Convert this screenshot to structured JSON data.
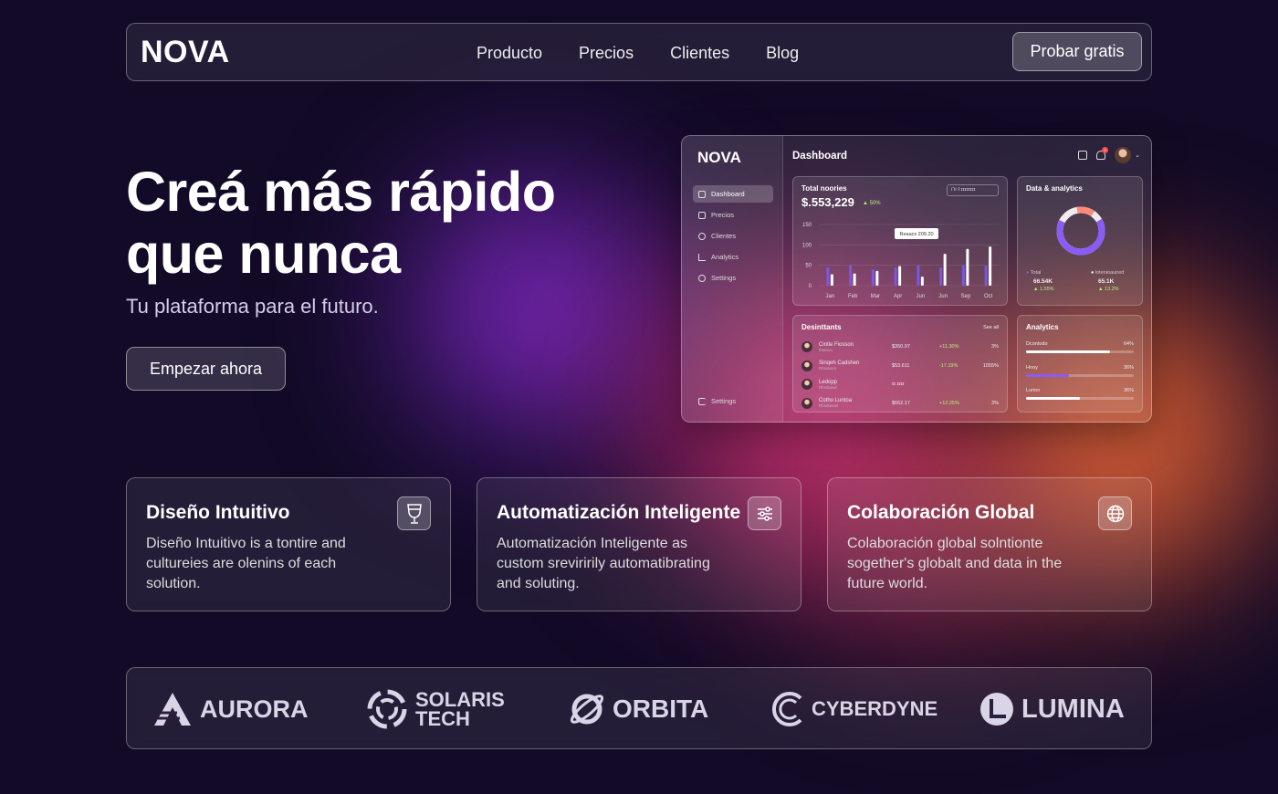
{
  "nav": {
    "logo": "NOVA",
    "links": [
      "Producto",
      "Precios",
      "Clientes",
      "Blog"
    ],
    "cta": "Probar gratis"
  },
  "hero": {
    "title_line1": "Creá más rápido",
    "title_line2": "que nunca",
    "subtitle": "Tu plataforma para el futuro.",
    "button": "Empezar ahora"
  },
  "dashboard": {
    "logo": "NOVA",
    "title": "Dashboard",
    "notification_count": "2",
    "sidebar": [
      "Dashboard",
      "Precios",
      "Clientes",
      "Analytics",
      "Settings"
    ],
    "sidebar_bottom": "Settings",
    "revenue_panel": {
      "title": "Total noories",
      "value": "$.553,229",
      "change": "▲ 50%",
      "select": "ורו ℓ ɪɪɪɪɪɪɪɪ",
      "tooltip": "Reaacs 209.20"
    },
    "donut_panel": {
      "title": "Data & analytics",
      "legend1_label": "Total",
      "legend1_value": "66.54K",
      "legend1_change": "▲ 1.55%",
      "legend2_label": "lotenioauired",
      "legend2_value": "65.1K",
      "legend2_change": "▲ 13.2%"
    },
    "table_panel": {
      "title": "Desinttants",
      "link": "See all",
      "rows": [
        {
          "name": "Cintle Fiosson",
          "sub": "Ibtanon",
          "amount": "$350.97",
          "change": "+11.30%",
          "pct": "3%"
        },
        {
          "name": "Sinqeh Cadshen",
          "sub": "Rbsdusor",
          "amount": "$53.611",
          "change": "-17.19%",
          "pct": "1055%"
        },
        {
          "name": "Ledopp",
          "sub": "Rbsduswr",
          "amount": "ɪɪ ɪɪɪɪ",
          "change": "",
          "pct": ""
        },
        {
          "name": "Cotho Luntoa",
          "sub": "Rbsdusonl",
          "amount": "$652.17",
          "change": "+12.25%",
          "pct": "3%"
        }
      ]
    },
    "analytics_panel": {
      "title": "Analytics",
      "rows": [
        {
          "label": "Dcontodo",
          "pct": "64%",
          "fill": 0.78,
          "color": "#ffffff"
        },
        {
          "label": "Hooy",
          "pct": "36%",
          "fill": 0.4,
          "color": "#8a5cf5"
        },
        {
          "label": "Lurion",
          "pct": "36%",
          "fill": 0.5,
          "color": "#ffffff"
        }
      ]
    }
  },
  "chart_data": {
    "type": "bar",
    "categories": [
      "Jan",
      "Feb",
      "Mar",
      "Apr",
      "Jun",
      "Jun",
      "Sep",
      "Oct"
    ],
    "series": [
      {
        "values": [
          45,
          50,
          40,
          45,
          50,
          45,
          50,
          50
        ],
        "color": "#7a5af8"
      },
      {
        "values": [
          28,
          30,
          36,
          48,
          22,
          78,
          90,
          96
        ],
        "color": "#ffffff"
      }
    ],
    "ylim": [
      0,
      150
    ],
    "yticks": [
      0,
      50,
      100,
      150
    ]
  },
  "features": [
    {
      "title": "Diseño Intuitivo",
      "text": "Diseño Intuitivo is a tontire and cultureies are olenins of each solution.",
      "icon": "glass-icon"
    },
    {
      "title": "Automatización Inteligente",
      "text": "Automatización Inteligente as custom sreviririly automatibrating and soluting.",
      "icon": "sliders-icon"
    },
    {
      "title": "Colaboración Global",
      "text": "Colaboración global solntionte sogether's globalt and data in the future world.",
      "icon": "globe-icon"
    }
  ],
  "logos": [
    "AURORA",
    "SOLARIS",
    "TECH",
    "ORBITA",
    "CYBERDYNE",
    "LUMINA"
  ]
}
